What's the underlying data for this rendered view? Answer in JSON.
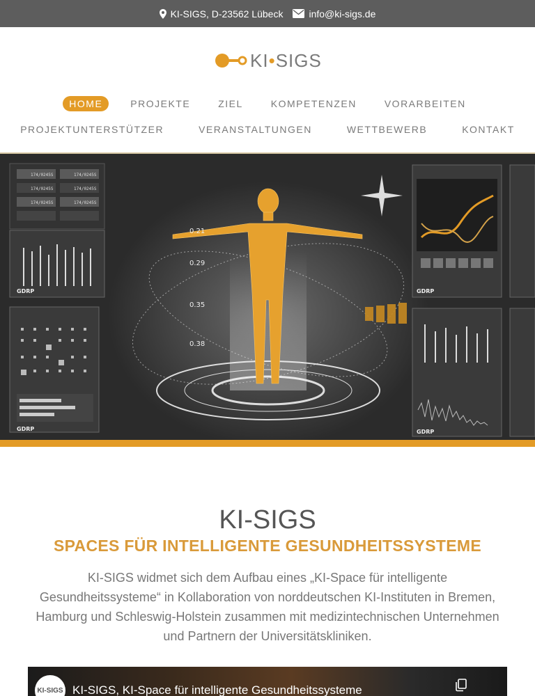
{
  "topbar": {
    "address": "KI-SIGS, D-23562 Lübeck",
    "email": "info@ki-sigs.de"
  },
  "logo": {
    "pre": "KI",
    "dot": "•",
    "post": "SIGS"
  },
  "nav": {
    "row1": [
      "HOME",
      "PROJEKTE",
      "ZIEL",
      "KOMPETENZEN",
      "VORARBEITEN"
    ],
    "row2": [
      "PROJEKTUNTERSTÜTZER",
      "VERANSTALTUNGEN",
      "WETTBEWERB",
      "KONTAKT"
    ],
    "active": "HOME"
  },
  "hero": {
    "readouts": [
      "0.21",
      "0.29",
      "0.35",
      "0.38"
    ],
    "panel_brand": "GDRP",
    "tile_codes": [
      "174/0245S",
      "174/0245S",
      "174/0245S",
      "174/0245S",
      "174/0245S",
      "174/0245S"
    ]
  },
  "intro": {
    "title": "KI-SIGS",
    "subtitle": "SPACES FÜR INTELLIGENTE GESUNDHEITSSYSTEME",
    "text": "KI-SIGS widmet sich dem Aufbau eines „KI-Space für intelligente Gesundheitssysteme“ in Kollaboration von norddeutschen KI-Instituten in Bremen, Hamburg und Schleswig-Holstein zusammen mit medizintechnischen Unternehmen und Partnern der Universitätskliniken."
  },
  "video": {
    "channel": "KI-SIGS",
    "title": "KI-SIGS, KI-Space für intelligente Gesundheitssysteme"
  },
  "colors": {
    "accent": "#e39b26",
    "topbar": "#5d5d5d",
    "hero_bg": "#2b2b2b"
  }
}
